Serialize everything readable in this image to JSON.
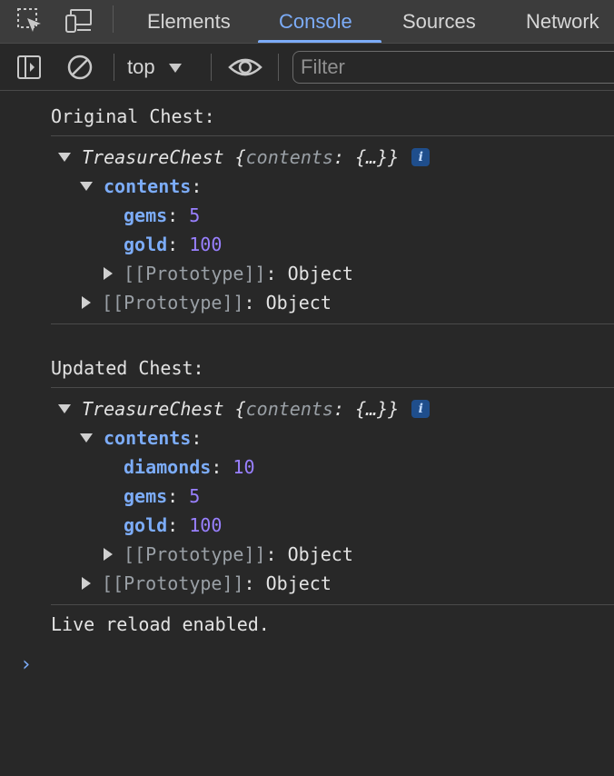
{
  "tabs": [
    {
      "label": "Elements"
    },
    {
      "label": "Console",
      "active": true
    },
    {
      "label": "Sources"
    },
    {
      "label": "Network"
    }
  ],
  "toolbar": {
    "context": "top",
    "filter_placeholder": "Filter"
  },
  "icons": {
    "inspect": "inspect-element-icon",
    "device": "device-toolbar-icon",
    "sidebar": "sidebar-toggle-icon",
    "clear": "clear-console-icon",
    "dropdown": "chevron-down-icon",
    "eye": "live-expression-icon",
    "info": "info-badge-icon",
    "prompt": "console-prompt-icon"
  },
  "colors": {
    "accent": "#7cacf8",
    "number": "#9980ff",
    "background": "#282828"
  },
  "console": {
    "logs": [
      {
        "label": "Original Chest:",
        "object": {
          "class_name": "TreasureChest",
          "preview_open": "{",
          "preview_key": "contents",
          "preview_sep": ": ",
          "preview_value": "{…}",
          "preview_close": "}",
          "info": "i",
          "contents_key": "contents",
          "colon": ":",
          "props": [
            {
              "key": "gems",
              "value": "5"
            },
            {
              "key": "gold",
              "value": "100"
            }
          ],
          "inner_proto_key": "[[Prototype]]",
          "inner_proto_value": "Object",
          "outer_proto_key": "[[Prototype]]",
          "outer_proto_value": "Object"
        }
      },
      {
        "label": "Updated Chest:",
        "object": {
          "class_name": "TreasureChest",
          "preview_open": "{",
          "preview_key": "contents",
          "preview_sep": ": ",
          "preview_value": "{…}",
          "preview_close": "}",
          "info": "i",
          "contents_key": "contents",
          "colon": ":",
          "props": [
            {
              "key": "diamonds",
              "value": "10"
            },
            {
              "key": "gems",
              "value": "5"
            },
            {
              "key": "gold",
              "value": "100"
            }
          ],
          "inner_proto_key": "[[Prototype]]",
          "inner_proto_value": "Object",
          "outer_proto_key": "[[Prototype]]",
          "outer_proto_value": "Object"
        }
      }
    ],
    "final_message": "Live reload enabled.",
    "prompt_symbol": "›"
  }
}
